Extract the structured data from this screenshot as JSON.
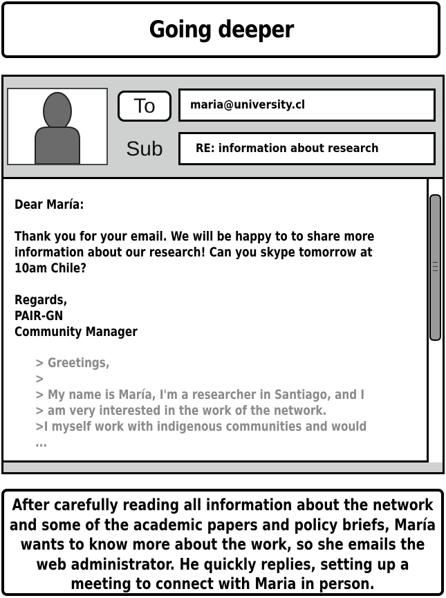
{
  "title": "Going deeper",
  "email": {
    "to_label": "To",
    "subject_label": "Sub",
    "to_value": "maria@university.cl",
    "subject_value": "RE: information about research",
    "body": {
      "greeting": "Dear María:",
      "message_lines": [
        "Thank you for your email. We will be happy to to share more",
        "information about our research! Can you skype tomorrow at",
        "10am Chile?"
      ],
      "signoff": "Regards,",
      "sender_name": "PAIR-GN",
      "sender_title": "Community Manager"
    },
    "quoted_lines": [
      "> Greetings,",
      ">",
      "> My name is María, I'm a researcher in Santiago, and I",
      "> am very interested in the work of the network.",
      ">I myself work with indigenous communities and would",
      "..."
    ]
  },
  "caption": "After carefully reading all information about the network and some of the academic papers and policy briefs, María wants to know more about the work, so she emails the web administrator. He quickly replies, setting up a meeting to connect with Maria in person.",
  "colors": {
    "chrome_gray": "#cfd0d0",
    "quote_gray": "#8a8a8a",
    "avatar_gray": "#6b6b6b",
    "border": "#000000"
  },
  "icons": {
    "avatar": "person-silhouette-icon"
  }
}
